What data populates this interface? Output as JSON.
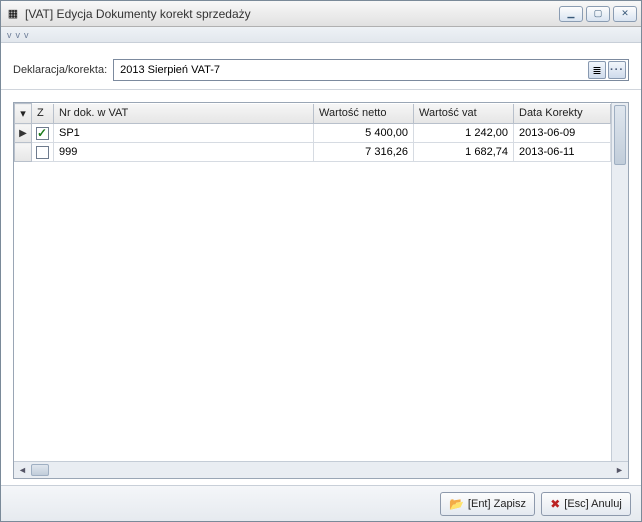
{
  "window": {
    "title": "[VAT] Edycja Dokumenty korekt sprzedaży"
  },
  "form": {
    "declaration_label": "Deklaracja/korekta:",
    "declaration_value": "2013 Sierpień VAT-7"
  },
  "grid": {
    "headers": {
      "selector": "▾",
      "z": "Z",
      "nr": "Nr dok. w VAT",
      "netto": "Wartość netto",
      "vat": "Wartość vat",
      "date": "Data Korekty"
    },
    "rows": [
      {
        "pointer": true,
        "checked": true,
        "nr": "SP1",
        "netto": "5 400,00",
        "vat": "1 242,00",
        "date": "2013-06-09"
      },
      {
        "pointer": false,
        "checked": false,
        "nr": "999",
        "netto": "7 316,26",
        "vat": "1 682,74",
        "date": "2013-06-11"
      }
    ]
  },
  "footer": {
    "save": "[Ent] Zapisz",
    "cancel": "[Esc] Anuluj"
  },
  "icons": {
    "minimize": "▁",
    "maximize": "▢",
    "close": "✕",
    "book": "≣",
    "more": "···",
    "folder": "📂",
    "cancel": "✖",
    "app": "▦"
  }
}
